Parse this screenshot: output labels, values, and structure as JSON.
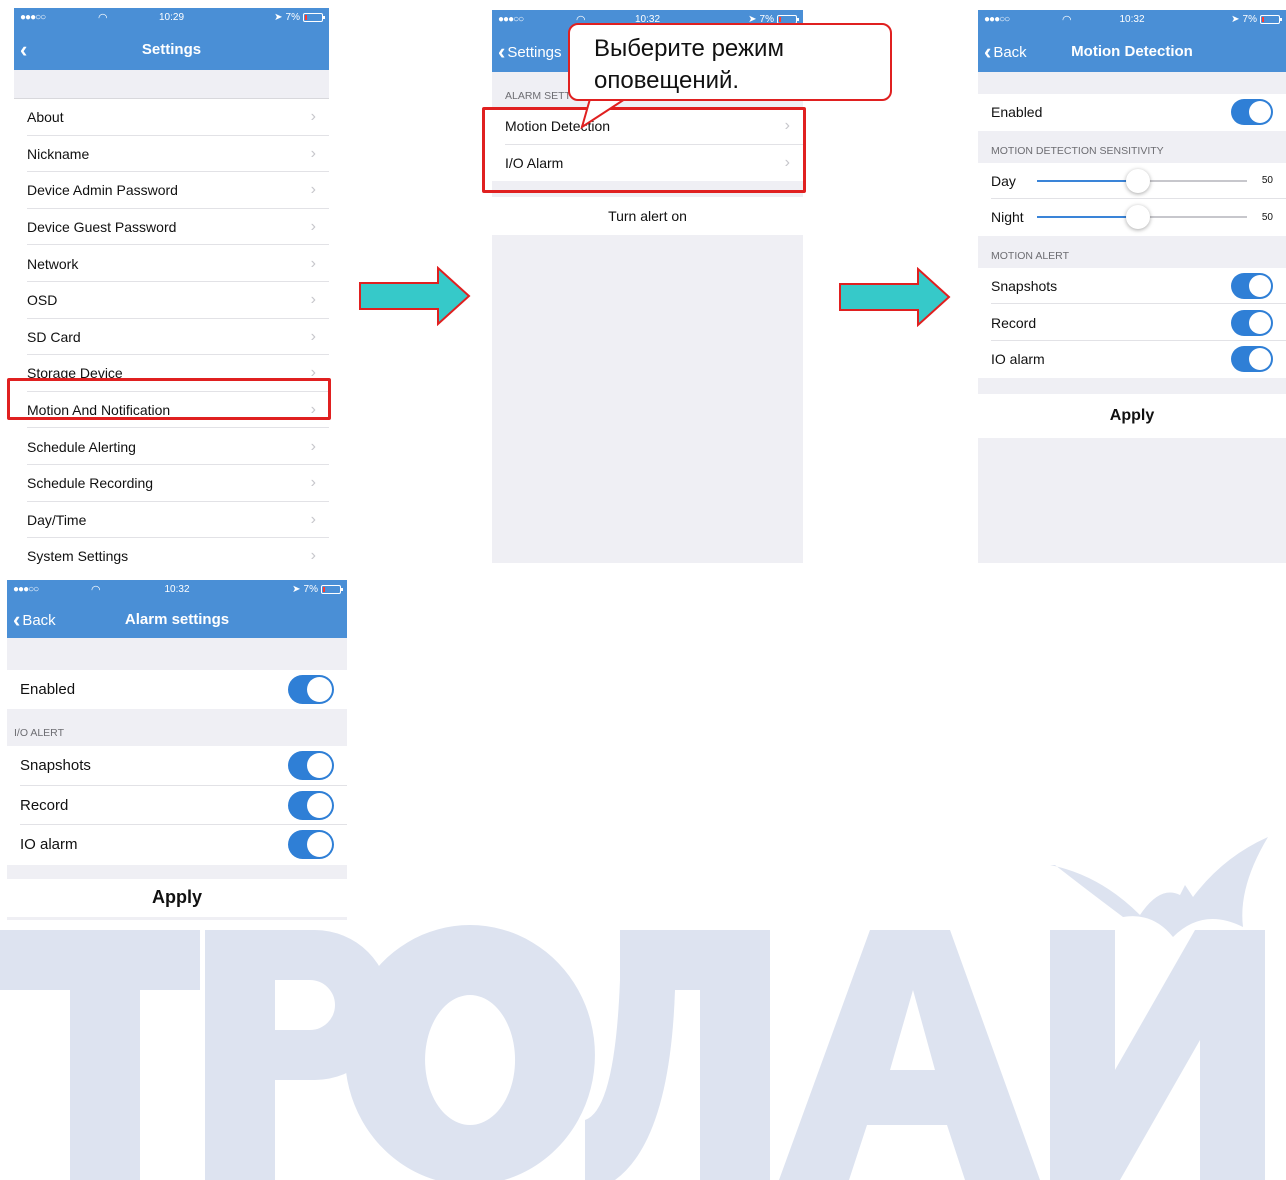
{
  "status": {
    "carrier": "●●●○○",
    "battery": "7%",
    "time1": "10:29",
    "time2": "10:32",
    "time3": "10:32",
    "time4": "10:32"
  },
  "screen1": {
    "title": "Settings",
    "items": [
      {
        "label": "About"
      },
      {
        "label": "Nickname"
      },
      {
        "label": "Device Admin Password"
      },
      {
        "label": "Device Guest Password"
      },
      {
        "label": "Network"
      },
      {
        "label": "OSD"
      },
      {
        "label": "SD Card"
      },
      {
        "label": "Storage Device"
      },
      {
        "label": "Motion And Notification"
      },
      {
        "label": "Schedule Alerting"
      },
      {
        "label": "Schedule Recording"
      },
      {
        "label": "Day/Time"
      },
      {
        "label": "System Settings"
      }
    ]
  },
  "screen2": {
    "back": "Settings",
    "section": "ALARM SETTINGS",
    "items": [
      {
        "label": "Motion Detection"
      },
      {
        "label": "I/O Alarm"
      }
    ],
    "action": "Turn alert on",
    "callout": "Выберите режим оповещений."
  },
  "screen3": {
    "back": "Back",
    "title": "Motion Detection",
    "enabled_label": "Enabled",
    "enabled": true,
    "sensitivity_header": "MOTION DETECTION SENSITIVITY",
    "day_label": "Day",
    "day_value": "50",
    "night_label": "Night",
    "night_value": "50",
    "alert_header": "MOTION ALERT",
    "alerts": [
      {
        "label": "Snapshots",
        "on": true
      },
      {
        "label": "Record",
        "on": true
      },
      {
        "label": "IO alarm",
        "on": true
      }
    ],
    "apply": "Apply"
  },
  "screen4": {
    "back": "Back",
    "title": "Alarm settings",
    "enabled_label": "Enabled",
    "enabled": true,
    "alert_header": "I/O ALERT",
    "alerts": [
      {
        "label": "Snapshots",
        "on": true
      },
      {
        "label": "Record",
        "on": true
      },
      {
        "label": "IO alarm",
        "on": true
      }
    ],
    "apply": "Apply"
  },
  "watermark": {
    "text": "IPOЛАЙ",
    "color": "#dde3f0"
  },
  "colors": {
    "navbar": "#4a8fd6",
    "highlight": "#e02020",
    "arrow_fill": "#36c9c9",
    "toggle_on": "#2f7fd6"
  }
}
